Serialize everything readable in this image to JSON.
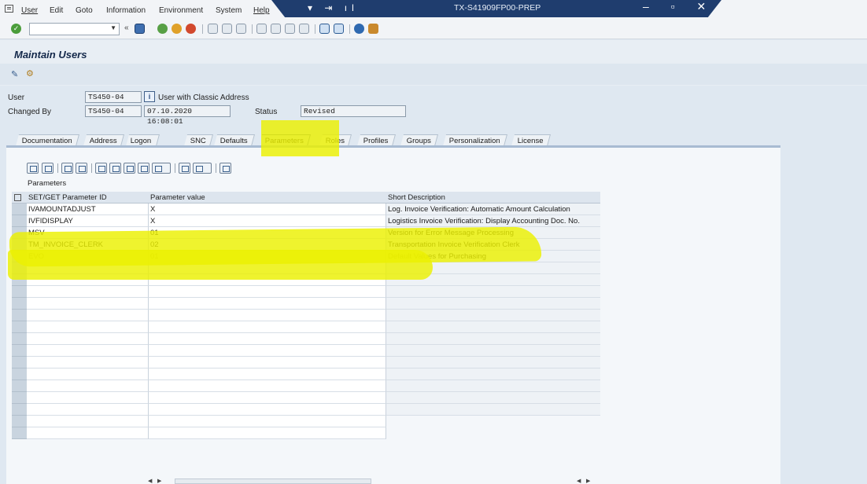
{
  "menu": {
    "items": [
      {
        "label": "User"
      },
      {
        "label": "Edit"
      },
      {
        "label": "Goto"
      },
      {
        "label": "Information"
      },
      {
        "label": "Environment"
      },
      {
        "label": "System"
      },
      {
        "label": "Help"
      }
    ]
  },
  "window": {
    "system_title": "TX-S41909FP00-PREP"
  },
  "toolbar": {
    "command_field_value": ""
  },
  "page": {
    "title": "Maintain Users"
  },
  "header": {
    "user_label": "User",
    "user_value": "TS450-04",
    "user_type": "User with Classic Address",
    "changed_by_label": "Changed By",
    "changed_by_value": "TS450-04",
    "changed_at": "07.10.2020 16:08:01",
    "status_label": "Status",
    "status_value": "Revised"
  },
  "tabs": [
    {
      "label": "Documentation",
      "active": false
    },
    {
      "label": "Address",
      "active": false
    },
    {
      "label": "Logon Data",
      "active": false
    },
    {
      "label": "SNC",
      "active": false
    },
    {
      "label": "Defaults",
      "active": false
    },
    {
      "label": "Parameters",
      "active": true
    },
    {
      "label": "Roles",
      "active": false
    },
    {
      "label": "Profiles",
      "active": false
    },
    {
      "label": "Groups",
      "active": false
    },
    {
      "label": "Personalization",
      "active": false
    },
    {
      "label": "License",
      "active": false
    }
  ],
  "grid": {
    "title": "Parameters",
    "columns": [
      "SET/GET Parameter ID",
      "Parameter value",
      "Short Description"
    ],
    "rows": [
      {
        "id": "IVAMOUNTADJUST",
        "value": "X",
        "desc": "Log. Invoice Verification: Automatic Amount Calculation"
      },
      {
        "id": "IVFIDISPLAY",
        "value": "X",
        "desc": "Logistics Invoice Verification: Display Accounting Doc. No."
      },
      {
        "id": "MSV",
        "value": "01",
        "desc": "Version for Error Message Processing"
      },
      {
        "id": "TM_INVOICE_CLERK",
        "value": "02",
        "desc": "Transportation Invoice Verification Clerk"
      },
      {
        "id": "EVO",
        "value": "01",
        "desc": "Default Values for Purchasing"
      }
    ]
  },
  "colors": {
    "title_band": "#1f3d6e",
    "highlight": "#ecf000",
    "tab_active": "#dde7f2"
  }
}
